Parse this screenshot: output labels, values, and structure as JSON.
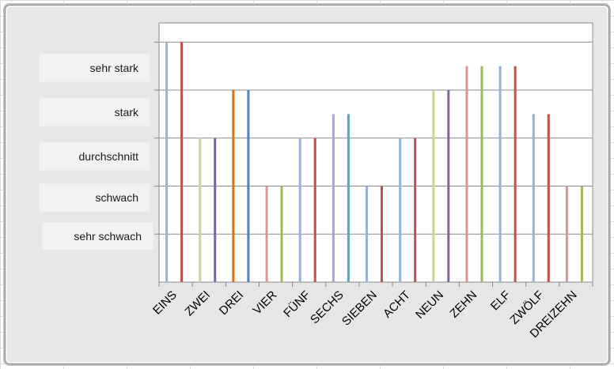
{
  "chart_data": {
    "type": "bar",
    "title": "",
    "xlabel": "",
    "ylabel": "",
    "levels": [
      "sehr schwach",
      "schwach",
      "durchschnitt",
      "stark",
      "sehr stark"
    ],
    "ylim": [
      0,
      5.4
    ],
    "grid": true,
    "legend": "none",
    "categories": [
      "EINS",
      "ZWEI",
      "DREI",
      "VIER",
      "FÜNF",
      "SECHS",
      "SIEBEN",
      "ACHT",
      "NEUN",
      "ZEHN",
      "ELF",
      "ZWÖLF",
      "DREIZEHN"
    ],
    "series": [
      {
        "values": [
          5,
          3,
          4,
          2,
          3,
          3.5,
          2,
          3,
          4,
          4.5,
          4.5,
          3.5,
          2
        ],
        "colors": [
          "#95b3d7",
          "#c3d69b",
          "#e46c0a",
          "#d99694",
          "#95b3d7",
          "#b3a2c7",
          "#95b3d7",
          "#95b3d7",
          "#c3d69b",
          "#d99694",
          "#95b3d7",
          "#95b3d7",
          "#d99694"
        ]
      },
      {
        "values": [
          5,
          3,
          4,
          2,
          3,
          3.5,
          2,
          3,
          4,
          4.5,
          4.5,
          3.5,
          2
        ],
        "colors": [
          "#c0504d",
          "#8064a2",
          "#4f81bd",
          "#9bbb59",
          "#c0504d",
          "#4bacc6",
          "#c0504d",
          "#c0504d",
          "#8064a2",
          "#9bbb59",
          "#c0504d",
          "#c0504d",
          "#9bbb59"
        ]
      }
    ]
  }
}
